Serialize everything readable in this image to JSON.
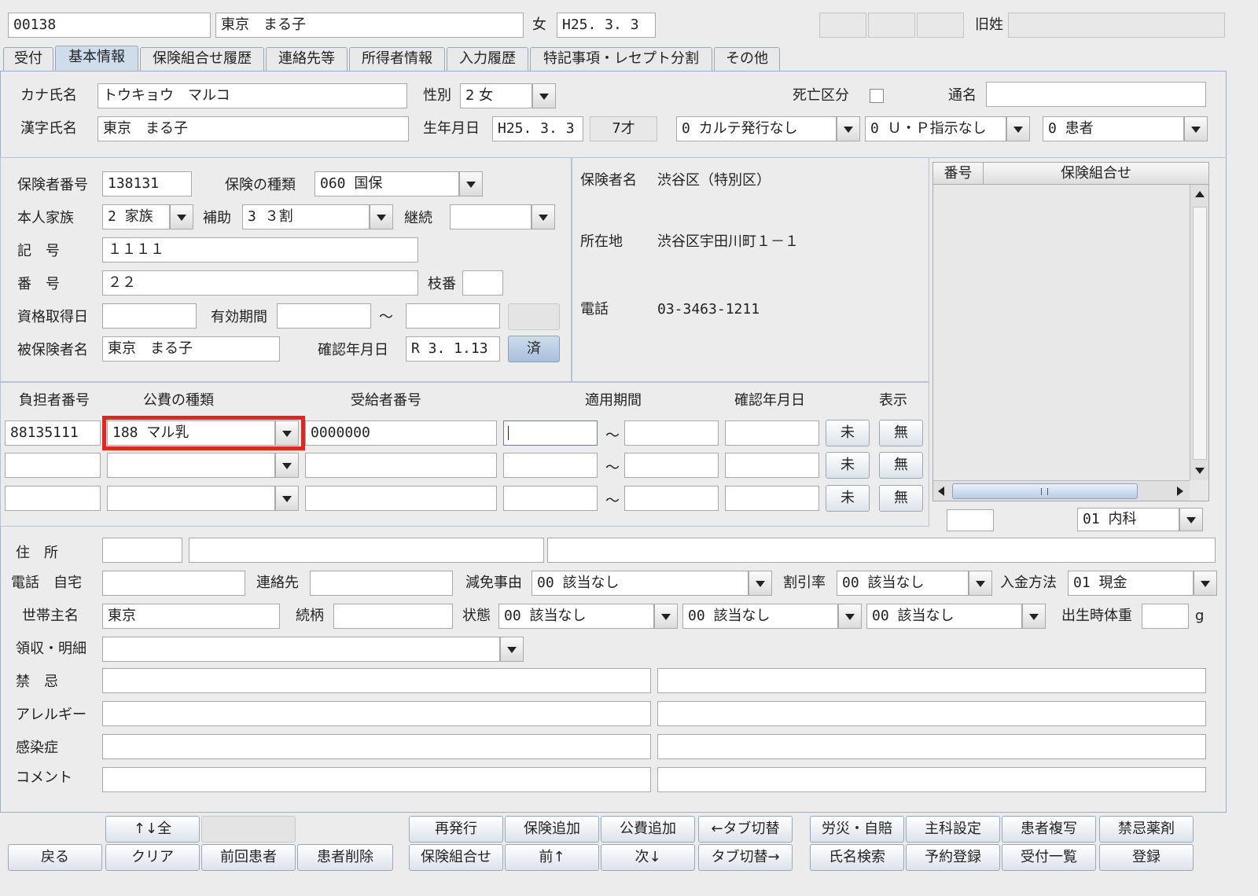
{
  "header": {
    "patient_id": "00138",
    "patient_name": "東京　まる子",
    "sex": "女",
    "birth": "H25. 3. 3",
    "maiden_label": "旧姓",
    "maiden_value": ""
  },
  "tabs": [
    "受付",
    "基本情報",
    "保険組合せ履歴",
    "連絡先等",
    "所得者情報",
    "入力履歴",
    "特記事項・レセプト分割",
    "その他"
  ],
  "active_tab": "基本情報",
  "basic": {
    "kana_label": "カナ氏名",
    "kana_value": "トウキョウ　マルコ",
    "kanji_label": "漢字氏名",
    "kanji_value": "東京　まる子",
    "sex_label": "性別",
    "sex_value": "2 女",
    "birth_label": "生年月日",
    "birth_value": "H25. 3. 3",
    "age": "7才",
    "death_label": "死亡区分",
    "alias_label": "通名",
    "alias_value": "",
    "karte_value": "0 カルテ発行なし",
    "up_value": "0 Ｕ・Ｐ指示なし",
    "patient_type_value": "0 患者"
  },
  "insurance": {
    "insurer_no_label": "保険者番号",
    "insurer_no": "138131",
    "type_label": "保険の種類",
    "type_value": "060 国保",
    "self_family_label": "本人家族",
    "self_family_value": "2 家族",
    "aid_label": "補助",
    "aid_value": "3 ３割",
    "continue_label": "継続",
    "continue_value": "",
    "symbol_label": "記　号",
    "symbol_value": "１１１１",
    "number_label": "番　号",
    "number_value": "２２",
    "branch_label": "枝番",
    "branch_value": "",
    "acquired_label": "資格取得日",
    "acquired_value": "",
    "valid_label": "有効期間",
    "valid_from": "",
    "tilde": "～",
    "valid_to": "",
    "insured_label": "被保険者名",
    "insured_value": "東京　まる子",
    "confirm_label": "確認年月日",
    "confirm_value": "R 3. 1.13",
    "done_button": "済"
  },
  "insurer_info": {
    "name_label": "保険者名",
    "name_value": "渋谷区（特別区）",
    "address_label": "所在地",
    "address_value": "渋谷区宇田川町１－１",
    "phone_label": "電話",
    "phone_value": "03-3463-1211"
  },
  "combo_table": {
    "col_number": "番号",
    "col_combo": "保険組合せ",
    "extra_value": "",
    "dept_value": "01 内科"
  },
  "public_expense": {
    "headers": [
      "負担者番号",
      "公費の種類",
      "受給者番号",
      "適用期間",
      "確認年月日",
      "表示"
    ],
    "rows": [
      {
        "payer": "88135111",
        "kind": "188 マル乳",
        "recipient": "0000000",
        "from": "",
        "to": "",
        "confirm": "",
        "mi": "未",
        "mu": "無"
      },
      {
        "payer": "",
        "kind": "",
        "recipient": "",
        "from": "",
        "to": "",
        "confirm": "",
        "mi": "未",
        "mu": "無"
      },
      {
        "payer": "",
        "kind": "",
        "recipient": "",
        "from": "",
        "to": "",
        "confirm": "",
        "mi": "未",
        "mu": "無"
      }
    ],
    "highlight_color": "#e8231a"
  },
  "contact": {
    "address_label": "住　所",
    "phone_label": "電話　自宅",
    "phone_value": "",
    "contact_label": "連絡先",
    "contact_value": "",
    "reduction_label": "減免事由",
    "reduction_value": "00 該当なし",
    "discount_label": "割引率",
    "discount_value": "00 該当なし",
    "payment_label": "入金方法",
    "payment_value": "01 現金",
    "householder_label": "世帯主名",
    "householder_value": "東京",
    "relation_label": "続柄",
    "relation_value": "",
    "status_label": "状態",
    "status1": "00 該当なし",
    "status2": "00 該当なし",
    "status3": "00 該当なし",
    "birth_weight_label": "出生時体重",
    "birth_weight_unit": "g",
    "birth_weight_value": "",
    "receipt_label": "領収・明細",
    "receipt_value": "",
    "taboo_label": "禁　忌",
    "allergy_label": "アレルギー",
    "infection_label": "感染症",
    "comment_label": "コメント"
  },
  "footer": {
    "top_row": [
      "↑↓全",
      "",
      "",
      "",
      "再発行",
      "保険追加",
      "公費追加",
      "←タブ切替",
      "労災・自賠",
      "主科設定",
      "患者複写",
      "禁忌薬剤"
    ],
    "bottom_row": [
      "戻る",
      "クリア",
      "前回患者",
      "患者削除",
      "保険組合せ",
      "前↑",
      "次↓",
      "タブ切替→",
      "氏名検索",
      "予約登録",
      "受付一覧",
      "登録"
    ]
  }
}
